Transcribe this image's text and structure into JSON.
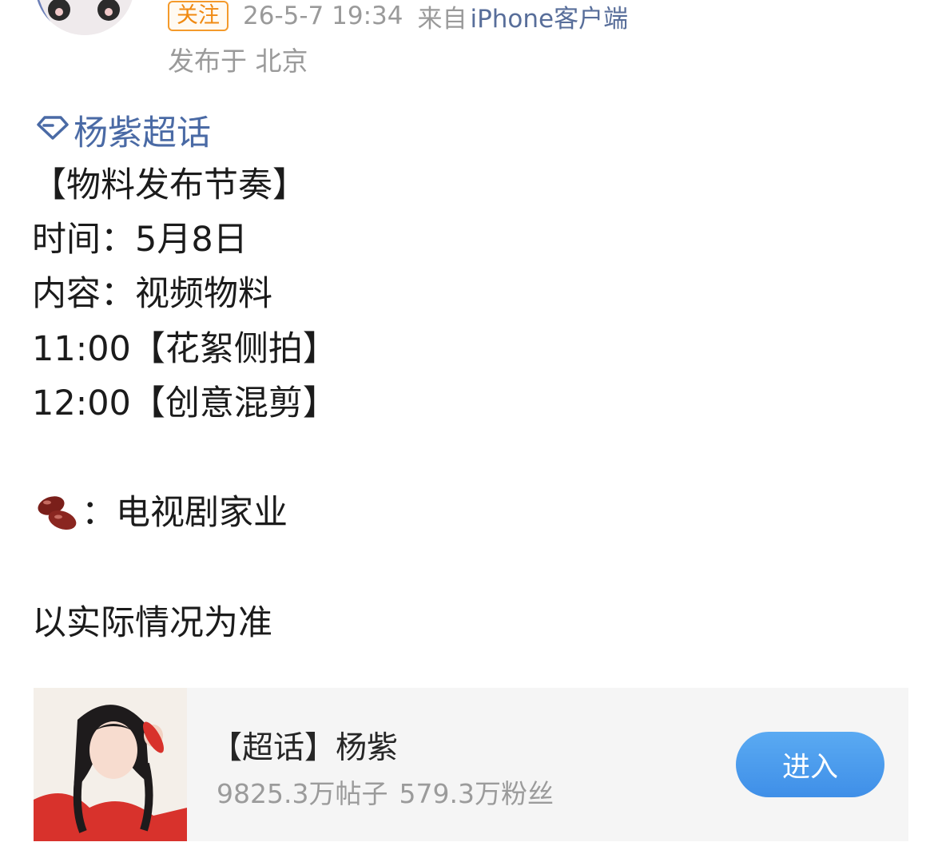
{
  "header": {
    "follow_label": "关注",
    "timestamp": "26-5-7 19:34",
    "source_prefix": "来自",
    "source_client": "iPhone客户端",
    "location": "发布于 北京"
  },
  "post": {
    "topic_icon": "diamond-icon",
    "topic": "杨紫超话",
    "lines": [
      "【物料发布节奏】",
      "时间：5月8日",
      "内容：视频物料",
      "11:00【花絮侧拍】",
      "12:00【创意混剪】"
    ],
    "beans_icon": "red-beans-emoji",
    "beans_text": "：电视剧家业",
    "footer_text": "以实际情况为准"
  },
  "card": {
    "title": "【超话】杨紫",
    "posts_count": "9825.3万帖子",
    "members_count": "579.3万粉丝",
    "enter_label": "进入"
  },
  "colors": {
    "follow_orange": "#f08a12",
    "link_blue": "#586e9a",
    "topic_blue": "#4a6aa5",
    "enter_button": "#4a9af0"
  }
}
